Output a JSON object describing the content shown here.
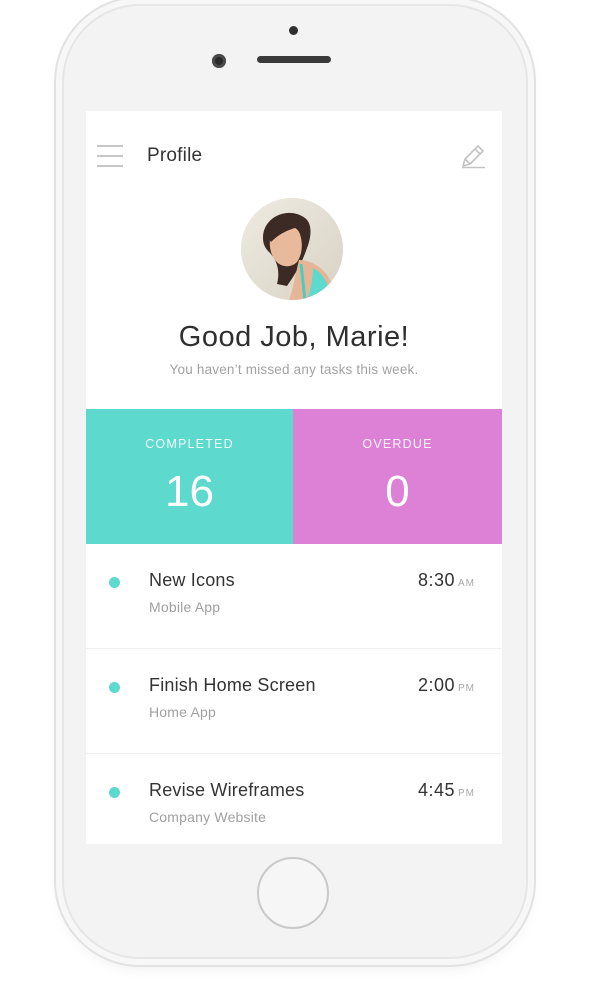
{
  "header": {
    "title": "Profile",
    "menu_icon": "hamburger-menu-icon",
    "edit_icon": "pencil-edit-icon"
  },
  "profile": {
    "avatar": "user-avatar-photo",
    "greeting": "Good Job, Marie!",
    "subtitle": "You haven’t missed any tasks this week."
  },
  "stats": {
    "completed": {
      "label": "COMPLETED",
      "value": "16",
      "color": "#5dd9cd"
    },
    "overdue": {
      "label": "OVERDUE",
      "value": "0",
      "color": "#dd81d6"
    }
  },
  "tasks": [
    {
      "title": "New Icons",
      "project": "Mobile App",
      "time": "8:30",
      "ampm": "AM"
    },
    {
      "title": "Finish Home Screen",
      "project": "Home App",
      "time": "2:00",
      "ampm": "PM"
    },
    {
      "title": "Revise Wireframes",
      "project": "Company Website",
      "time": "4:45",
      "ampm": "PM"
    }
  ],
  "colors": {
    "accent_teal": "#5dd9cd",
    "accent_pink": "#dd81d6"
  }
}
